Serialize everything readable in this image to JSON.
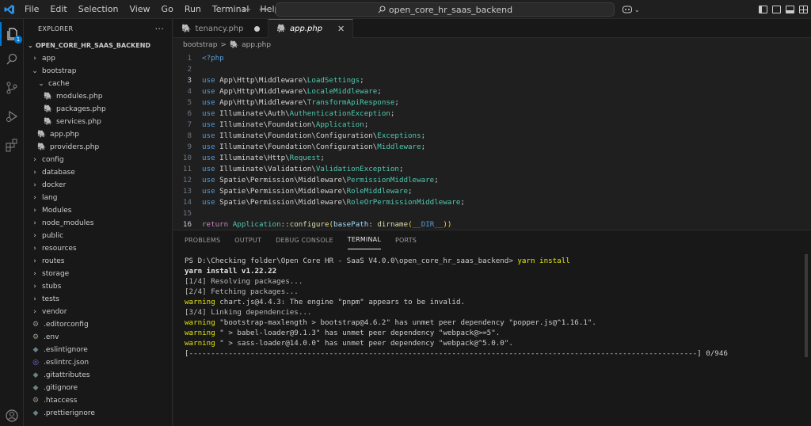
{
  "menu": [
    "File",
    "Edit",
    "Selection",
    "View",
    "Go",
    "Run",
    "Terminal",
    "Help"
  ],
  "search": {
    "text": "open_core_hr_saas_backend"
  },
  "explorer": {
    "header": "EXPLORER",
    "more": "···",
    "root": "OPEN_CORE_HR_SAAS_BACKEND",
    "items": [
      {
        "label": "app",
        "type": "folder",
        "depth": 0,
        "open": false
      },
      {
        "label": "bootstrap",
        "type": "folder",
        "depth": 0,
        "open": true
      },
      {
        "label": "cache",
        "type": "folder",
        "depth": 1,
        "open": true
      },
      {
        "label": "modules.php",
        "type": "php",
        "depth": 2
      },
      {
        "label": "packages.php",
        "type": "php",
        "depth": 2
      },
      {
        "label": "services.php",
        "type": "php",
        "depth": 2
      },
      {
        "label": "app.php",
        "type": "php",
        "depth": 1
      },
      {
        "label": "providers.php",
        "type": "php",
        "depth": 1
      },
      {
        "label": "config",
        "type": "folder",
        "depth": 0,
        "open": false
      },
      {
        "label": "database",
        "type": "folder",
        "depth": 0,
        "open": false
      },
      {
        "label": "docker",
        "type": "folder",
        "depth": 0,
        "open": false
      },
      {
        "label": "lang",
        "type": "folder",
        "depth": 0,
        "open": false
      },
      {
        "label": "Modules",
        "type": "folder",
        "depth": 0,
        "open": false
      },
      {
        "label": "node_modules",
        "type": "folder",
        "depth": 0,
        "open": false
      },
      {
        "label": "public",
        "type": "folder",
        "depth": 0,
        "open": false
      },
      {
        "label": "resources",
        "type": "folder",
        "depth": 0,
        "open": false
      },
      {
        "label": "routes",
        "type": "folder",
        "depth": 0,
        "open": false
      },
      {
        "label": "storage",
        "type": "folder",
        "depth": 0,
        "open": false
      },
      {
        "label": "stubs",
        "type": "folder",
        "depth": 0,
        "open": false
      },
      {
        "label": "tests",
        "type": "folder",
        "depth": 0,
        "open": false
      },
      {
        "label": "vendor",
        "type": "folder",
        "depth": 0,
        "open": false
      },
      {
        "label": ".editorconfig",
        "type": "cfg",
        "depth": 0
      },
      {
        "label": ".env",
        "type": "cfg",
        "depth": 0
      },
      {
        "label": ".eslintignore",
        "type": "ignore",
        "depth": 0
      },
      {
        "label": ".eslintrc.json",
        "type": "eslint",
        "depth": 0
      },
      {
        "label": ".gitattributes",
        "type": "ignore",
        "depth": 0
      },
      {
        "label": ".gitignore",
        "type": "ignore",
        "depth": 0
      },
      {
        "label": ".htaccess",
        "type": "cfg",
        "depth": 0
      },
      {
        "label": ".prettierignore",
        "type": "ignore",
        "depth": 0
      }
    ]
  },
  "tabs": [
    {
      "label": "tenancy.php",
      "dirty": true,
      "active": false
    },
    {
      "label": "app.php",
      "dirty": false,
      "active": true
    }
  ],
  "breadcrumb": {
    "folder": "bootstrap",
    "sep": ">",
    "file": "app.php"
  },
  "code": [
    {
      "n": "1",
      "t": "<?php",
      "k": "kw"
    },
    {
      "n": "2",
      "t": "",
      "k": ""
    },
    {
      "n": "3",
      "t": "use App\\Http\\Middleware\\LoadSettings;",
      "k": "use",
      "ns": "App\\Http\\Middleware\\",
      "cls": "LoadSettings"
    },
    {
      "n": "4",
      "t": "use App\\Http\\Middleware\\LocaleMiddleware;",
      "k": "use",
      "ns": "App\\Http\\Middleware\\",
      "cls": "LocaleMiddleware"
    },
    {
      "n": "5",
      "t": "",
      "k": "use",
      "ns": "App\\Http\\Middleware\\",
      "cls": "TransformApiResponse"
    },
    {
      "n": "6",
      "t": "",
      "k": "use",
      "ns": "Illuminate\\Auth\\",
      "cls": "AuthenticationException"
    },
    {
      "n": "7",
      "t": "",
      "k": "use",
      "ns": "Illuminate\\Foundation\\",
      "cls": "Application"
    },
    {
      "n": "8",
      "t": "",
      "k": "use",
      "ns": "Illuminate\\Foundation\\Configuration\\",
      "cls": "Exceptions"
    },
    {
      "n": "9",
      "t": "",
      "k": "use",
      "ns": "Illuminate\\Foundation\\Configuration\\",
      "cls": "Middleware"
    },
    {
      "n": "10",
      "t": "",
      "k": "use",
      "ns": "Illuminate\\Http\\",
      "cls": "Request"
    },
    {
      "n": "11",
      "t": "",
      "k": "use",
      "ns": "Illuminate\\Validation\\",
      "cls": "ValidationException"
    },
    {
      "n": "12",
      "t": "",
      "k": "use",
      "ns": "Spatie\\Permission\\Middleware\\",
      "cls": "PermissionMiddleware"
    },
    {
      "n": "13",
      "t": "",
      "k": "use",
      "ns": "Spatie\\Permission\\Middleware\\",
      "cls": "RoleMiddleware"
    },
    {
      "n": "14",
      "t": "",
      "k": "use",
      "ns": "Spatie\\Permission\\Middleware\\",
      "cls": "RoleOrPermissionMiddleware"
    },
    {
      "n": "15",
      "t": "",
      "k": ""
    },
    {
      "n": "16",
      "t": "",
      "k": "return"
    }
  ],
  "code_last": {
    "ret": "return",
    "cls": "Application",
    "op": "::",
    "fn": "configure",
    "open": "(",
    "par": "basePath",
    "colon": ": ",
    "fn2": "dirname",
    "open2": "(",
    "const": "__DIR__",
    "close": "))"
  },
  "panel": {
    "tabs": [
      "PROBLEMS",
      "OUTPUT",
      "DEBUG CONSOLE",
      "TERMINAL",
      "PORTS"
    ],
    "active_tab": "TERMINAL"
  },
  "terminal": {
    "prompt": "PS D:\\Checking folder\\Open Core HR - SaaS V4.0.0\\open_core_hr_saas_backend> ",
    "command": "yarn install",
    "lines": [
      {
        "style": "bold",
        "text": "yarn install v1.22.22"
      },
      {
        "style": "dim",
        "text": "[1/4] Resolving packages..."
      },
      {
        "style": "dim",
        "text": "[2/4] Fetching packages..."
      },
      {
        "style": "warn",
        "prefix": "warning",
        "text": " chart.js@4.4.3: The engine \"pnpm\" appears to be invalid."
      },
      {
        "style": "dim",
        "text": "[3/4] Linking dependencies..."
      },
      {
        "style": "warn",
        "prefix": "warning",
        "text": " \"bootstrap-maxlength > bootstrap@4.6.2\" has unmet peer dependency \"popper.js@^1.16.1\"."
      },
      {
        "style": "warn",
        "prefix": "warning",
        "text": " \" > babel-loader@9.1.3\" has unmet peer dependency \"webpack@>=5\"."
      },
      {
        "style": "warn",
        "prefix": "warning",
        "text": " \" > sass-loader@14.0.0\" has unmet peer dependency \"webpack@^5.0.0\"."
      }
    ],
    "progress_bar": "[--------------------------------------------------------------------------------------------------------------------] 0/946"
  }
}
